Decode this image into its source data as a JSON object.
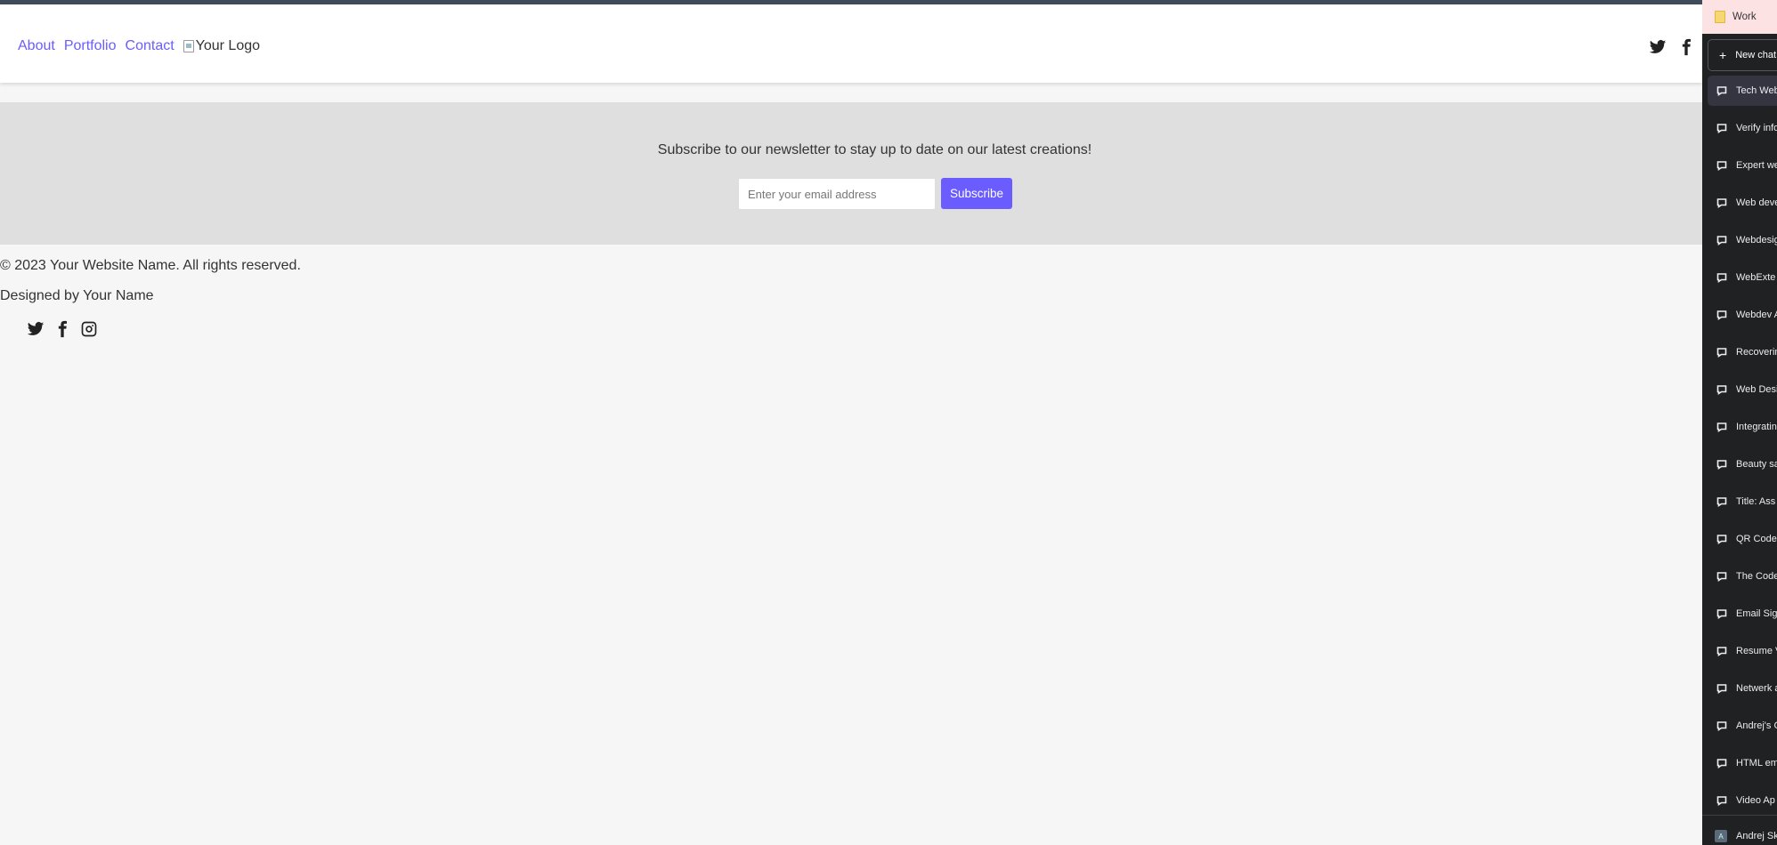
{
  "header": {
    "nav": [
      "About",
      "Portfolio",
      "Contact"
    ],
    "logo_alt": "Your Logo",
    "social_icons": [
      "twitter-icon",
      "facebook-icon",
      "instagram-icon"
    ]
  },
  "newsletter": {
    "text": "Subscribe to our newsletter to stay up to date on our latest creations!",
    "email_placeholder": "Enter your email address",
    "subscribe_label": "Subscribe"
  },
  "footer": {
    "copyright": "© 2023 Your Website Name. All rights reserved.",
    "designed_by": "Designed by Your Name"
  },
  "sidebar": {
    "folder_label": "Work",
    "new_chat_label": "New chat",
    "chats": [
      "Tech Web",
      "Verify info",
      "Expert we",
      "Web deve",
      "Webdesig",
      "WebExte",
      "Webdev A",
      "Recoverin",
      "Web Desi",
      "Integratin",
      "Beauty sa",
      "Title: Ass",
      "QR Code",
      "The Code",
      "Email Sig",
      "Resume V",
      "Netwerk a",
      "Andrej's C",
      "HTML em",
      "Video Ap"
    ],
    "user_name": "Andrej Sk",
    "user_initial": "A"
  },
  "colors": {
    "accent": "#6a5cff",
    "sidebar_bg": "#202123",
    "newsletter_bg": "#dfdfdf",
    "page_bg": "#f6f6f6"
  }
}
